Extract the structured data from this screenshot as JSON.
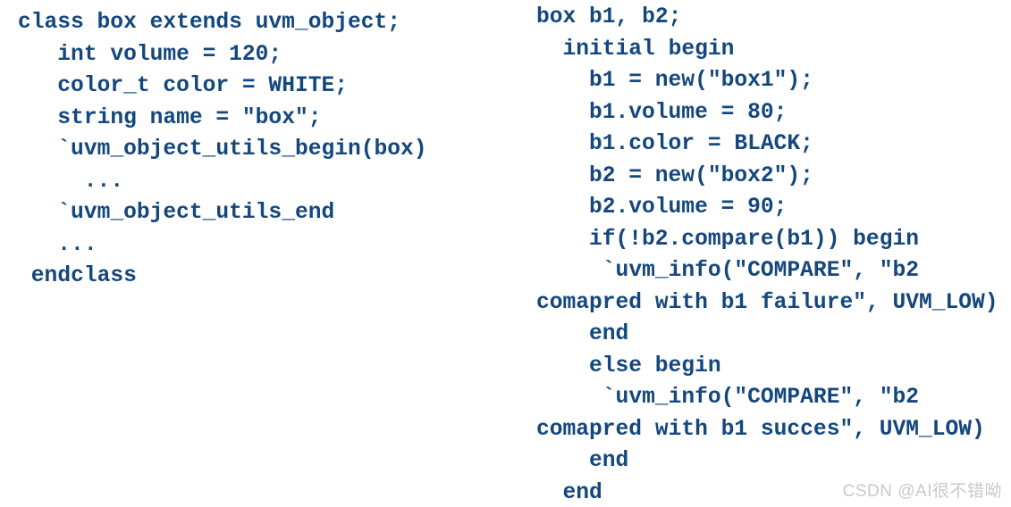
{
  "theme": {
    "background_color": "#ffffff",
    "code_text_color": "#14477d",
    "watermark_color": "#c9c9c9"
  },
  "left_column": {
    "name": "box class definition",
    "lines": [
      {
        "indent": 0,
        "text": "class box extends uvm_object;"
      },
      {
        "indent": 3,
        "text": "int volume = 120;"
      },
      {
        "indent": 3,
        "text": "color_t color = WHITE;"
      },
      {
        "indent": 3,
        "text": "string name = \"box\";"
      },
      {
        "indent": 3,
        "text": "`uvm_object_utils_begin(box)"
      },
      {
        "indent": 5,
        "text": "..."
      },
      {
        "indent": 3,
        "text": "`uvm_object_utils_end"
      },
      {
        "indent": 3,
        "text": "..."
      },
      {
        "indent": 1,
        "text": "endclass"
      }
    ]
  },
  "right_column": {
    "name": "testbench initial block",
    "lines": [
      {
        "indent": 0,
        "text": "box b1, b2;"
      },
      {
        "indent": 2,
        "text": "initial begin"
      },
      {
        "indent": 4,
        "text": "b1 = new(\"box1\");"
      },
      {
        "indent": 4,
        "text": "b1.volume = 80;"
      },
      {
        "indent": 4,
        "text": "b1.color = BLACK;"
      },
      {
        "indent": 4,
        "text": "b2 = new(\"box2\");"
      },
      {
        "indent": 4,
        "text": "b2.volume = 90;"
      },
      {
        "indent": 4,
        "text": "if(!b2.compare(b1)) begin"
      },
      {
        "indent": 5,
        "text": "`uvm_info(\"COMPARE\", \"b2"
      },
      {
        "indent": 0,
        "text": "comapred with b1 failure\", UVM_LOW)"
      },
      {
        "indent": 4,
        "text": "end"
      },
      {
        "indent": 4,
        "text": "else begin"
      },
      {
        "indent": 5,
        "text": "`uvm_info(\"COMPARE\", \"b2"
      },
      {
        "indent": 0,
        "text": "comapred with b1 succes\", UVM_LOW)"
      },
      {
        "indent": 4,
        "text": "end"
      },
      {
        "indent": 2,
        "text": "end"
      }
    ]
  },
  "watermark": {
    "text": "CSDN @AI很不错呦"
  }
}
